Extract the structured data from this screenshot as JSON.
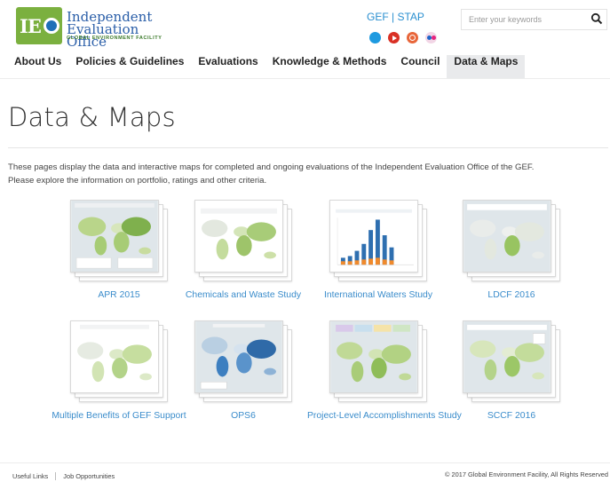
{
  "header": {
    "logo": {
      "name_line1": "Independent",
      "name_line2": "Evaluation Office",
      "subtitle": "GLOBAL ENVIRONMENT FACILITY",
      "badge_text": "IEO"
    },
    "gef_link": "GEF | STAP",
    "social_icons": [
      "twitter-icon",
      "youtube-icon",
      "instagram-icon",
      "flickr-icon"
    ],
    "search": {
      "placeholder": "Enter your keywords",
      "value": ""
    }
  },
  "nav": {
    "items": [
      {
        "label": "About Us"
      },
      {
        "label": "Policies & Guidelines"
      },
      {
        "label": "Evaluations"
      },
      {
        "label": "Knowledge & Methods"
      },
      {
        "label": "Council"
      },
      {
        "label": "Data & Maps",
        "active": true
      }
    ]
  },
  "main": {
    "title": "Data & Maps",
    "intro_line1": "These pages display the data and interactive maps for completed and ongoing evaluations of the Independent Evaluation Office of the GEF.",
    "intro_line2": "Please explore the information on portfolio, ratings and other criteria.",
    "gallery": [
      {
        "label": "APR 2015",
        "thumb": "world-map-green"
      },
      {
        "label": "Chemicals and Waste Study",
        "thumb": "world-map-green"
      },
      {
        "label": "International Waters Study",
        "thumb": "bar-chart"
      },
      {
        "label": "LDCF 2016",
        "thumb": "world-map-africa"
      },
      {
        "label": "Multiple Benefits of GEF Support",
        "thumb": "world-map-light"
      },
      {
        "label": "OPS6",
        "thumb": "world-map-blue"
      },
      {
        "label": "Project-Level Accomplishments Study",
        "thumb": "world-map-green"
      },
      {
        "label": "SCCF 2016",
        "thumb": "world-map-green"
      }
    ]
  },
  "footer": {
    "links": [
      "Useful Links",
      "Job Opportunities"
    ],
    "copyright": "© 2017 Global Environment Facility, All Rights Reserved"
  },
  "colors": {
    "link": "#3a8ccb",
    "logo_green": "#7bb03f",
    "logo_blue": "#2a5ea8",
    "nav_active_bg": "#e9eaec"
  }
}
